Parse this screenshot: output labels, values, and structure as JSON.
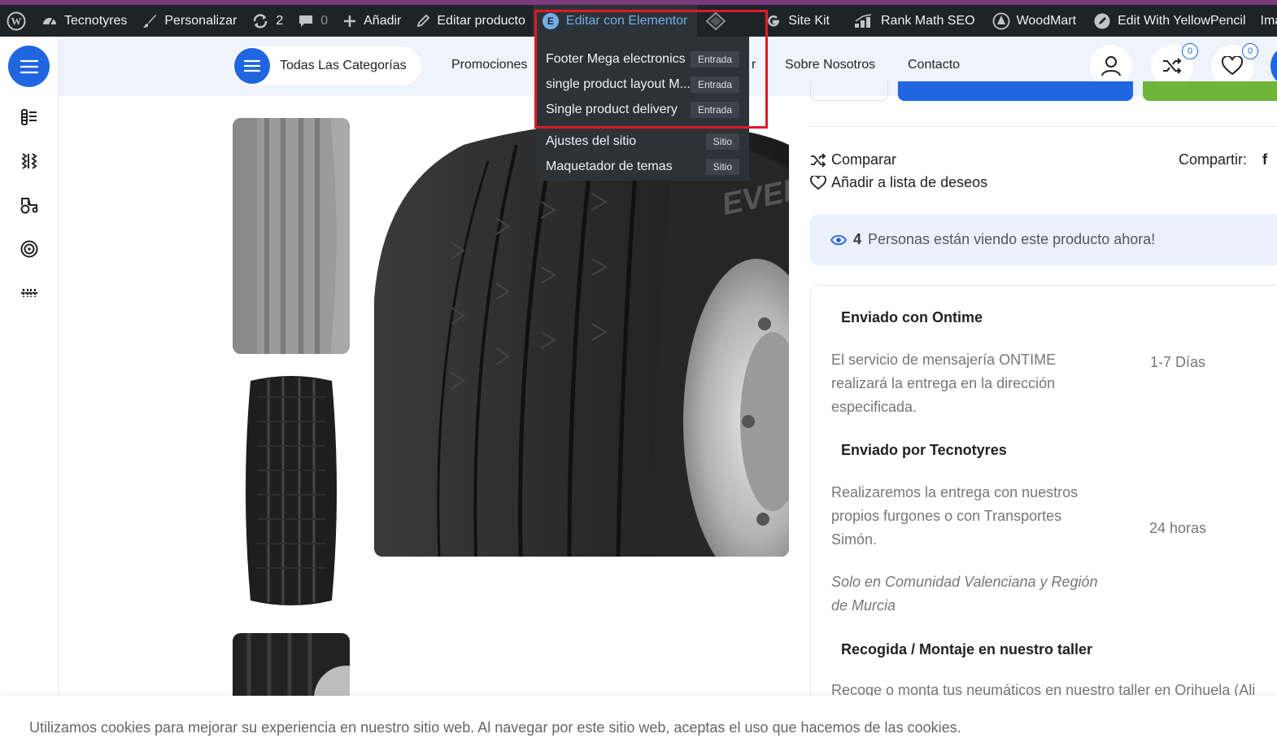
{
  "adminbar": {
    "site": "Tecnotyres",
    "customize": "Personalizar",
    "updates": "2",
    "comments": "0",
    "add": "Añadir",
    "edit_product": "Editar producto",
    "elementor": "Editar con Elementor",
    "sitekit": "Site Kit",
    "rankmath": "Rank Math SEO",
    "woodmart": "WoodMart",
    "yellowpencil": "Edit With YellowPencil",
    "imagify": "Imagify"
  },
  "dropdown": {
    "items": [
      {
        "label": "Footer Mega electronics",
        "tag": "Entrada"
      },
      {
        "label": "single product layout M...",
        "tag": "Entrada"
      },
      {
        "label": "Single product delivery",
        "tag": "Entrada"
      },
      {
        "label": "Ajustes del sitio",
        "tag": "Sitio"
      },
      {
        "label": "Maquetador de temas",
        "tag": "Sitio"
      }
    ]
  },
  "nav": {
    "categories": "Todas Las Categorías",
    "promotions": "Promociones",
    "hidden_tail": "r",
    "about": "Sobre Nosotros",
    "contact": "Contacto",
    "compare_count": "0",
    "wishlist_count": "0"
  },
  "product": {
    "compare": "Comparar",
    "wishlist": "Añadir a lista de deseos",
    "share": "Compartir:",
    "viewers_count": "4",
    "viewers_text": "Personas están viendo este producto ahora!",
    "tire_brand_text": "EVERGR"
  },
  "shipping": {
    "ontime_title": "Enviado con Ontime",
    "ontime_text": "El servicio de mensajería ONTIME realizará la entrega en la dirección especificada.",
    "ontime_time": "1-7 Días",
    "tecno_title": "Enviado por Tecnotyres",
    "tecno_text": "Realizaremos la entrega con nuestros propios furgones o con Transportes Simón.",
    "tecno_time": "24 horas",
    "tecno_note": "Solo en Comunidad Valenciana y Región de Murcia",
    "pickup_title": "Recogida / Montaje en nuestro taller",
    "pickup_text": "Recoge o monta tus neumáticos en nuestro taller en Orihuela (Ali"
  },
  "cookie": {
    "text": "Utilizamos cookies para mejorar su experiencia en nuestro sitio web. Al navegar por este sitio web, aceptas el uso que hacemos de las cookies."
  },
  "colors": {
    "brand_blue": "#1f66e0",
    "admin_bar": "#1d2327",
    "highlight": "#e01b24",
    "green": "#6fb53a"
  }
}
